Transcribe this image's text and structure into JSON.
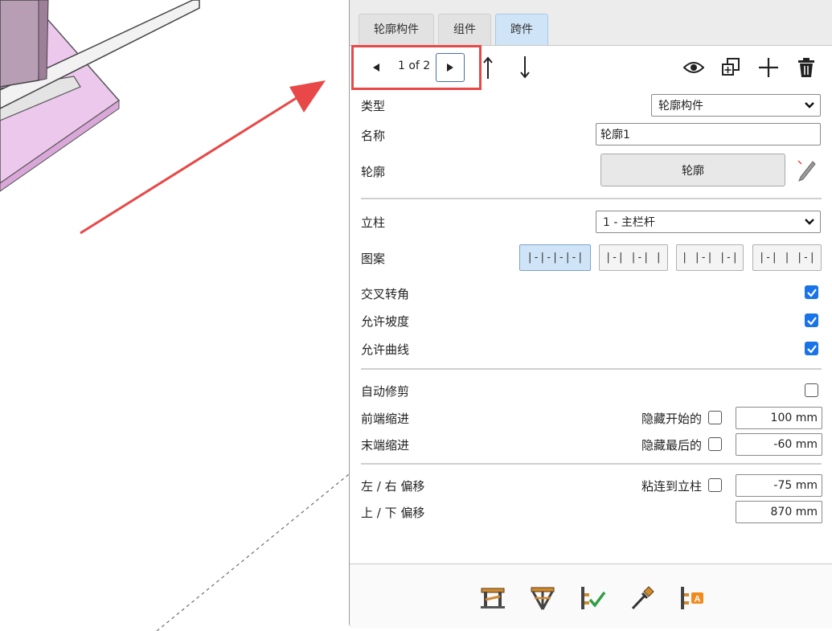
{
  "tabs": [
    {
      "label": "轮廓构件",
      "active": false
    },
    {
      "label": "组件",
      "active": false
    },
    {
      "label": "跨件",
      "active": true
    }
  ],
  "nav": {
    "page": "1 of 2"
  },
  "icons": {
    "prev": "triangle-left-icon",
    "next": "triangle-right-icon",
    "move_up": "arrow-up-icon",
    "move_down": "arrow-down-icon",
    "visibility": "eye-icon",
    "duplicate": "duplicate-icon",
    "add": "plus-icon",
    "delete": "trash-icon",
    "edit_profile": "pencil-icon"
  },
  "fields": {
    "type": {
      "label": "类型",
      "value": "轮廓构件"
    },
    "name": {
      "label": "名称",
      "value": "轮廓1"
    },
    "profile": {
      "label": "轮廓",
      "button": "轮廓"
    },
    "post": {
      "label": "立柱",
      "value": "1 - 主栏杆"
    },
    "pattern": {
      "label": "图案",
      "options": [
        "|-|-|-|-|",
        "|-| |-| |",
        "| |-| |-|",
        "|-| | |-|"
      ],
      "selected_index": 0
    },
    "cross_corners": {
      "label": "交叉转角",
      "checked": true
    },
    "allow_slope": {
      "label": "允许坡度",
      "checked": true
    },
    "allow_curve": {
      "label": "允许曲线",
      "checked": true
    },
    "auto_trim": {
      "label": "自动修剪",
      "checked": false
    },
    "start_indent": {
      "label": "前端缩进",
      "hide_label": "隐藏开始的",
      "hide_checked": false,
      "value": "100 mm"
    },
    "end_indent": {
      "label": "末端缩进",
      "hide_label": "隐藏最后的",
      "hide_checked": false,
      "value": "-60 mm"
    },
    "lr_offset": {
      "label": "左 / 右 偏移",
      "attach_label": "粘连到立柱",
      "attach_checked": false,
      "value": "-75 mm"
    },
    "ud_offset": {
      "label": "上 / 下 偏移",
      "value": "870 mm"
    }
  },
  "footer_icons": [
    "railing-tool-icon",
    "railing-fan-icon",
    "railing-check-icon",
    "eyedropper-icon",
    "railing-label-icon"
  ],
  "colors": {
    "accent": "#1a73e8",
    "highlight": "#e84848",
    "active_tab": "#cfe4f7",
    "scene_purple": "#ecc8ec"
  }
}
